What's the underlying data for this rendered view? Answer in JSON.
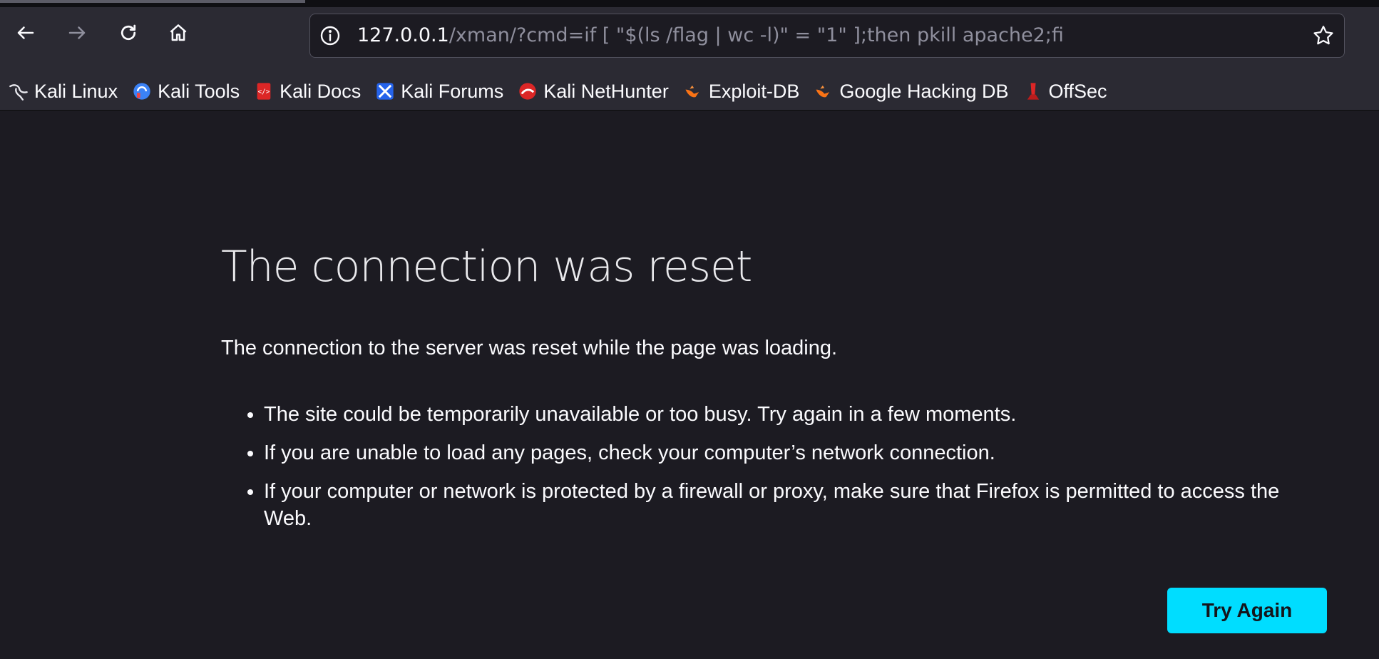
{
  "browser": {
    "nav": {
      "back_icon": "arrow-left-icon",
      "forward_icon": "arrow-right-icon",
      "reload_icon": "reload-icon",
      "home_icon": "home-icon"
    },
    "urlbar": {
      "host": "127.0.0.1",
      "path": "/xman/?cmd=if [ \"$(ls /flag | wc -l)\" = \"1\" ];then pkill apache2;fi",
      "info_icon": "info-icon",
      "bookmark_icon": "star-icon"
    },
    "bookmarks": [
      {
        "label": "Kali Linux",
        "icon": "kali-dragon-icon"
      },
      {
        "label": "Kali Tools",
        "icon": "kali-tools-icon"
      },
      {
        "label": "Kali Docs",
        "icon": "kali-docs-icon"
      },
      {
        "label": "Kali Forums",
        "icon": "kali-forums-icon"
      },
      {
        "label": "Kali NetHunter",
        "icon": "nethunter-icon"
      },
      {
        "label": "Exploit-DB",
        "icon": "exploit-db-icon"
      },
      {
        "label": "Google Hacking DB",
        "icon": "ghdb-icon"
      },
      {
        "label": "OffSec",
        "icon": "offsec-icon"
      }
    ]
  },
  "error": {
    "title": "The connection was reset",
    "description": "The connection to the server was reset while the page was loading.",
    "reasons": [
      "The site could be temporarily unavailable or too busy. Try again in a few moments.",
      "If you are unable to load any pages, check your computer’s network connection.",
      "If your computer or network is protected by a firewall or proxy, make sure that Firefox is permitted to access the Web."
    ],
    "button_label": "Try Again"
  },
  "colors": {
    "page_bg": "#1c1b22",
    "toolbar_bg": "#2b2a33",
    "accent": "#00ddff",
    "text": "#fbfbfe",
    "url_dim": "#8f8f9d"
  }
}
